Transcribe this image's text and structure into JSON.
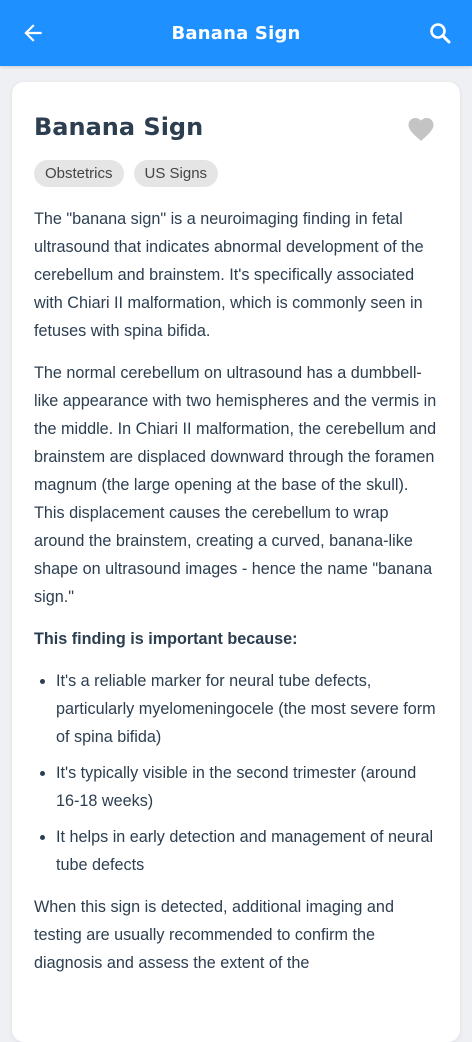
{
  "appbar": {
    "title": "Banana Sign",
    "back_icon": "arrow-left-icon",
    "search_icon": "search-icon",
    "color": "#1e90ff"
  },
  "article": {
    "title": "Banana Sign",
    "favorite_icon": "heart-icon",
    "tags": [
      "Obstetrics",
      "US Signs"
    ],
    "paragraph1": "The \"banana sign\" is a neuroimaging finding in fetal ultrasound that indicates abnormal development of the cerebellum and brainstem. It's specifically associated with Chiari II malformation, which is commonly seen in fetuses with spina bifida.",
    "paragraph2": "The normal cerebellum on ultrasound has a dumbbell-like appearance with two hemispheres and the vermis in the middle. In Chiari II malformation, the cerebellum and brainstem are displaced downward through the foramen magnum (the large opening at the base of the skull). This displacement causes the cerebellum to wrap around the brainstem, creating a curved, banana-like shape on ultrasound images - hence the name \"banana sign.\"",
    "subheading": "This finding is important because:",
    "bullets": [
      "It's a reliable marker for neural tube defects, particularly myelomeningocele (the most severe form of spina bifida)",
      "It's typically visible in the second trimester (around 16-18 weeks)",
      "It helps in early detection and management of neural tube defects"
    ],
    "paragraph3": "When this sign is detected, additional imaging and testing are usually recommended to confirm the diagnosis and assess the extent of the"
  }
}
